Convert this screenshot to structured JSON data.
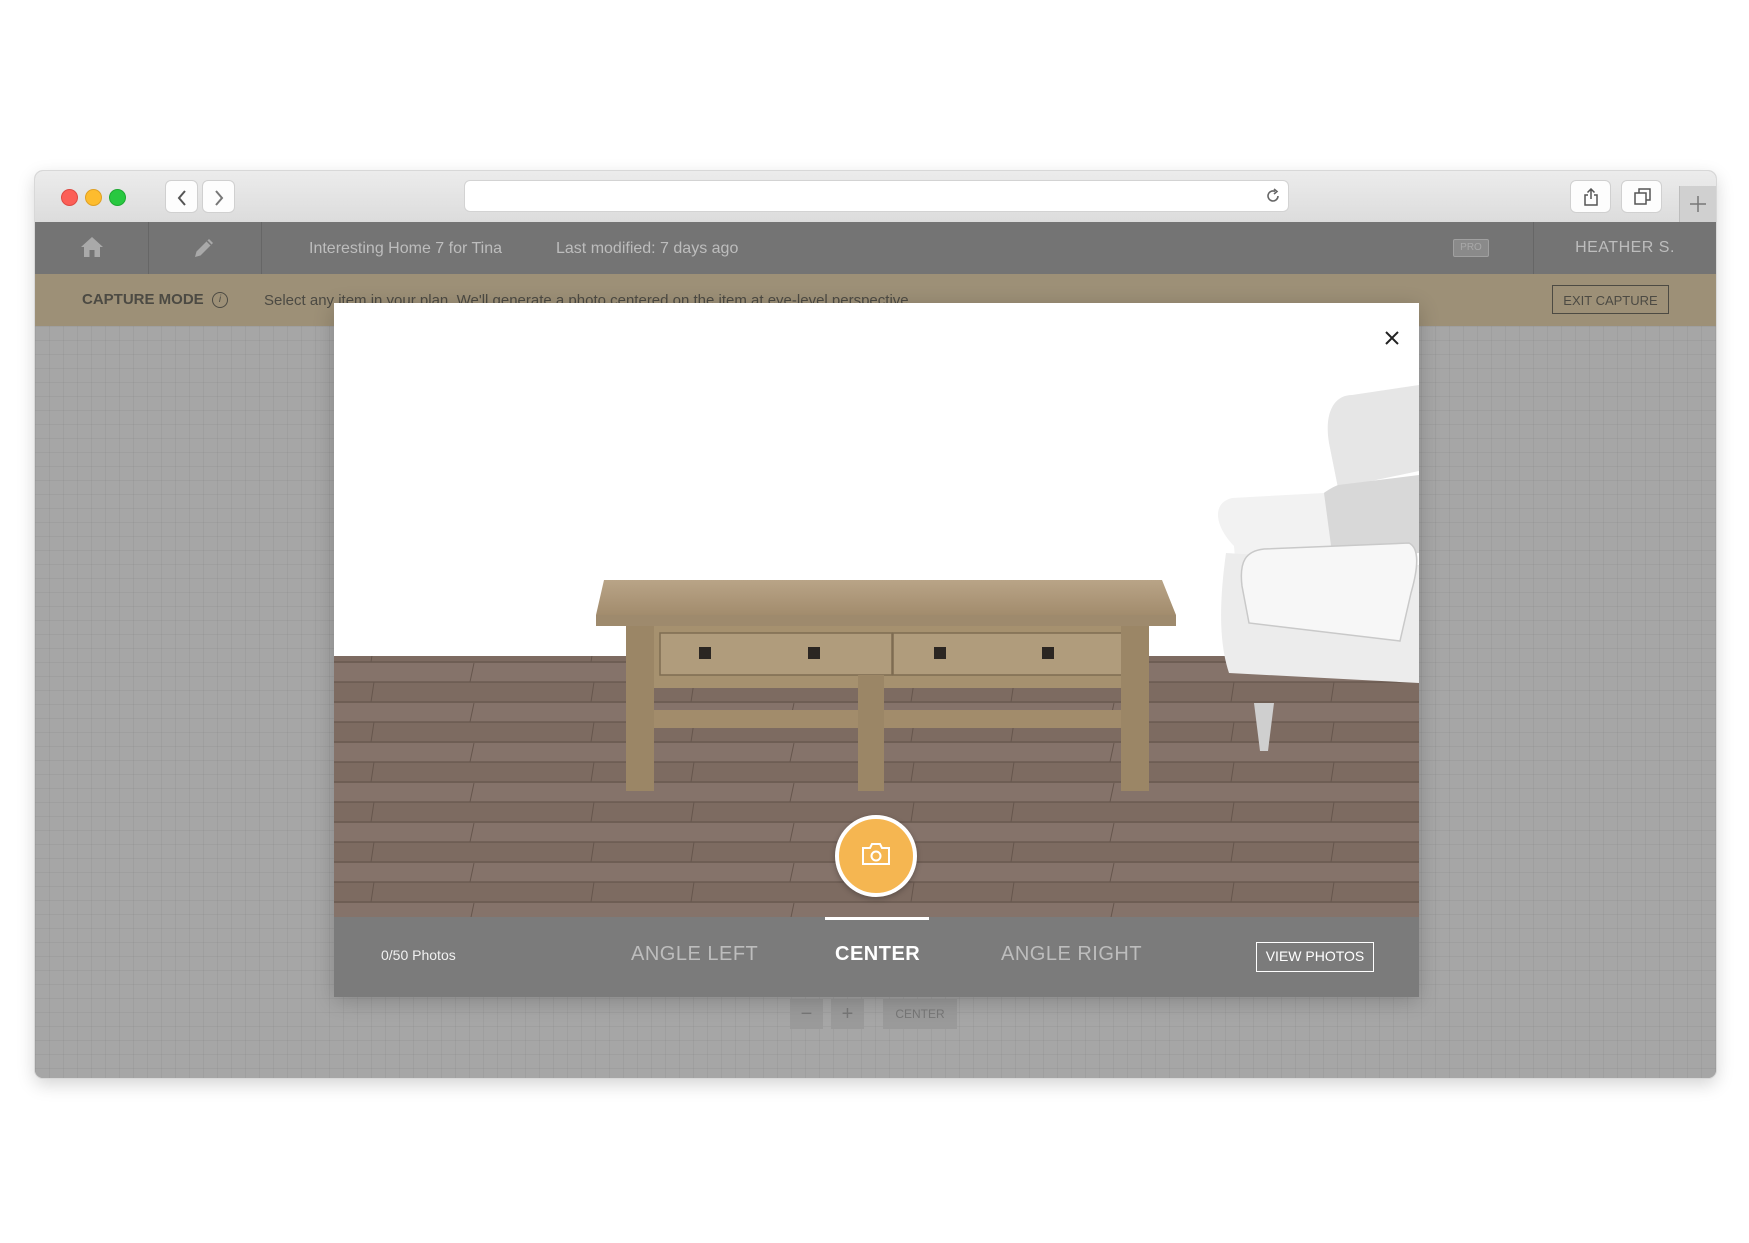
{
  "browser": {
    "url": ""
  },
  "header": {
    "project_name": "Interesting Home 7 for Tina",
    "last_modified": "Last modified: 7 days ago",
    "pro_badge": "PRO",
    "user_name": "HEATHER S."
  },
  "capture_bar": {
    "mode_label": "CAPTURE MODE",
    "info_glyph": "i",
    "hint": "Select any item in your plan. We'll generate a photo centered on the item at eye-level perspective.",
    "exit_label": "EXIT CAPTURE"
  },
  "zoom_controls": {
    "minus": "−",
    "plus": "+",
    "center": "CENTER"
  },
  "modal": {
    "photo_count": "0/50 Photos",
    "tabs": [
      {
        "label": "ANGLE LEFT",
        "active": false
      },
      {
        "label": "CENTER",
        "active": true
      },
      {
        "label": "ANGLE RIGHT",
        "active": false
      }
    ],
    "view_photos_label": "VIEW PHOTOS"
  },
  "colors": {
    "app_bar": "#747474",
    "capture_bar": "#9d9077",
    "shutter_accent": "#f5b651",
    "floor": "#7e6c62"
  },
  "icons": [
    "home-icon",
    "pencil-icon",
    "info-icon",
    "close-icon",
    "camera-icon",
    "reload-icon",
    "share-icon",
    "tabs-icon",
    "plus-icon",
    "chevron-left-icon",
    "chevron-right-icon"
  ]
}
